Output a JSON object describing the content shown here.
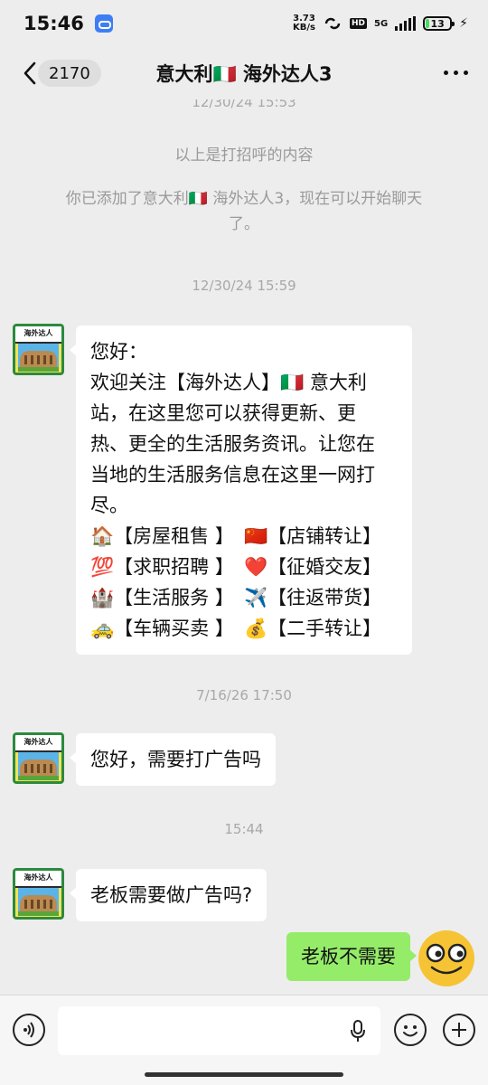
{
  "status_bar": {
    "time": "15:46",
    "net_speed_value": "3.73",
    "net_speed_unit": "KB/s",
    "hd": "HD",
    "signal": "5G",
    "battery": "13"
  },
  "header": {
    "unread_count": "2170",
    "title": "意大利🇮🇹 海外达人3"
  },
  "messages": {
    "ts_partial": "12/30/24 15:53",
    "sys_greeting": "以上是打招呼的内容",
    "sys_added_line1": "你已添加了意大利🇮🇹 海外达人3，现在可以开始聊天",
    "sys_added_line2": "了。",
    "ts1": "12/30/24 15:59",
    "avatar_text": "海外达人",
    "welcome": {
      "line1": "您好：",
      "line2": " 欢迎关注【海外达人】🇮🇹 意大利",
      "line3": "站，在这里您可以获得更新、更",
      "line4": "热、更全的生活服务资讯。让您在",
      "line5": "当地的生活服务信息在这里一网打",
      "line6": "尽。",
      "services": [
        [
          "🏠【房屋租售 】",
          "🇨🇳【店铺转让】"
        ],
        [
          "💯【求职招聘 】",
          "❤️【征婚交友】"
        ],
        [
          "🏰【生活服务 】",
          "✈️【往返带货】"
        ],
        [
          "🚕【车辆买卖 】",
          "💰【二手转让】"
        ]
      ]
    },
    "ts2": "7/16/26 17:50",
    "msg2": "您好，需要打广告吗",
    "ts3": "15:44",
    "msg3": "老板需要做广告吗?",
    "my_msg": "老板不需要"
  },
  "colors": {
    "background": "#ededed",
    "my_bubble": "#95ec69",
    "their_bubble": "#ffffff"
  }
}
